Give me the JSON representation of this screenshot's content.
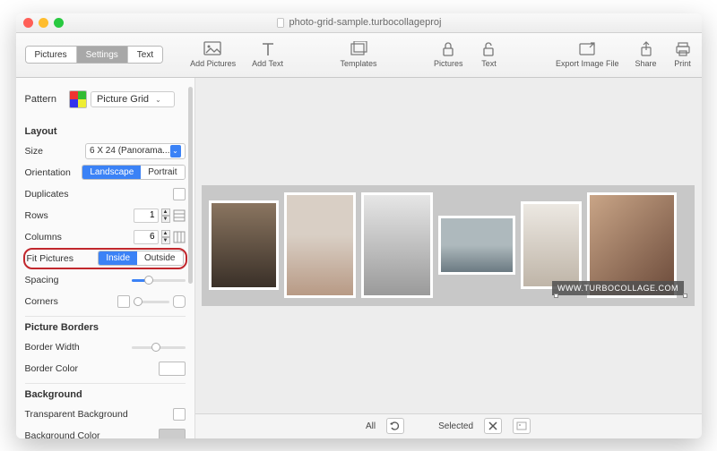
{
  "title": "photo-grid-sample.turbocollageproj",
  "tabs": {
    "pictures": "Pictures",
    "settings": "Settings",
    "text": "Text",
    "active": "settings"
  },
  "toolbar": {
    "addPictures": "Add Pictures",
    "addText": "Add Text",
    "templates": "Templates",
    "lockPictures": "Pictures",
    "lockText": "Text",
    "exportImageFile": "Export Image File",
    "share": "Share",
    "print": "Print"
  },
  "pattern": {
    "label": "Pattern",
    "value": "Picture Grid"
  },
  "layout": {
    "heading": "Layout",
    "sizeLabel": "Size",
    "sizeValue": "6 X 24 (Panorama...",
    "orientationLabel": "Orientation",
    "orientation": {
      "landscape": "Landscape",
      "portrait": "Portrait",
      "active": "landscape"
    },
    "duplicatesLabel": "Duplicates",
    "rowsLabel": "Rows",
    "rowsValue": "1",
    "columnsLabel": "Columns",
    "columnsValue": "6",
    "fitLabel": "Fit Pictures",
    "fit": {
      "inside": "Inside",
      "outside": "Outside",
      "active": "inside"
    },
    "spacingLabel": "Spacing",
    "cornersLabel": "Corners"
  },
  "pictureBorders": {
    "heading": "Picture Borders",
    "widthLabel": "Border Width",
    "colorLabel": "Border Color"
  },
  "background": {
    "heading": "Background",
    "transparentLabel": "Transparent Background",
    "colorLabel": "Background Color"
  },
  "footer": {
    "all": "All",
    "selected": "Selected"
  },
  "watermark": "WWW.TURBOCOLLAGE.COM"
}
